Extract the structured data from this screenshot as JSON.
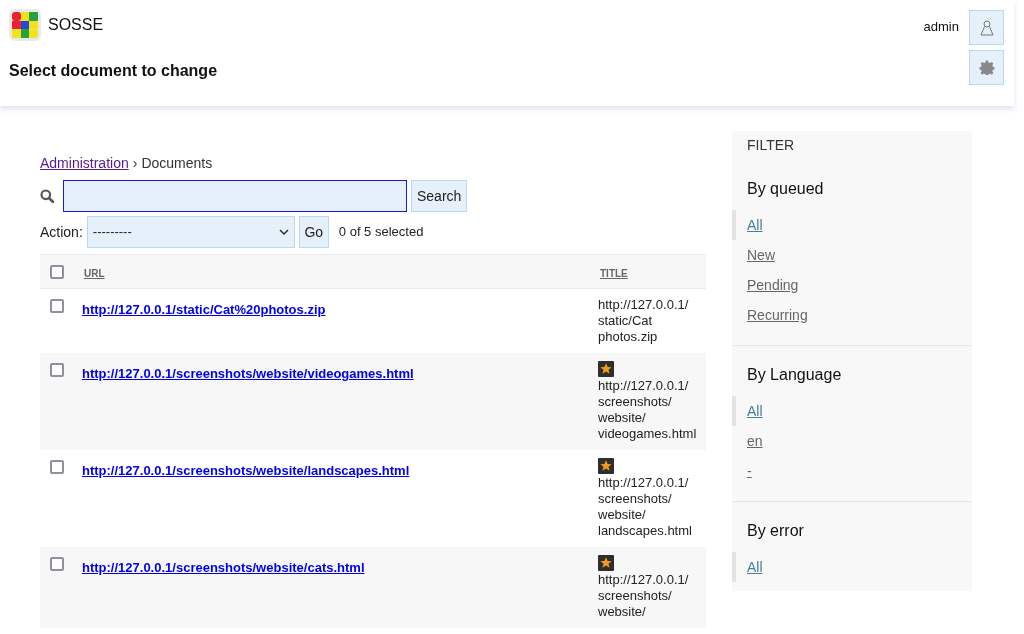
{
  "header": {
    "brand": "SOSSE",
    "page_title": "Select document to change",
    "username": "admin"
  },
  "breadcrumb": {
    "link": "Administration",
    "separator": "›",
    "current": "Documents"
  },
  "search": {
    "focused": true,
    "button": "Search"
  },
  "actions": {
    "label": "Action:",
    "selected_option": "---------",
    "button": "Go",
    "counter": "0 of 5 selected"
  },
  "table": {
    "select_all": {
      "checked": false
    },
    "columns": [
      "URL",
      "TITLE"
    ],
    "rows": [
      {
        "url": "http://127.0.0.1/static/Cat%20photos.zip",
        "title": "http://127.0.0.1/static/Cat photos.zip",
        "has_icon": false,
        "checked": false
      },
      {
        "url": "http://127.0.0.1/screenshots/website/videogames.html",
        "title": "http://127.0.0.1/screenshots/website/videogames.html",
        "has_icon": true,
        "checked": false
      },
      {
        "url": "http://127.0.0.1/screenshots/website/landscapes.html",
        "title": "http://127.0.0.1/screenshots/website/landscapes.html",
        "has_icon": true,
        "checked": false
      },
      {
        "url": "http://127.0.0.1/screenshots/website/cats.html",
        "title": "http://127.0.0.1/screenshots/website/",
        "has_icon": true,
        "checked": false
      }
    ]
  },
  "filter": {
    "heading": "FILTER",
    "groups": [
      {
        "title": "By queued",
        "options": [
          {
            "label": "All",
            "selected": true
          },
          {
            "label": "New",
            "selected": false
          },
          {
            "label": "Pending",
            "selected": false
          },
          {
            "label": "Recurring",
            "selected": false
          }
        ]
      },
      {
        "title": "By Language",
        "options": [
          {
            "label": "All",
            "selected": true
          },
          {
            "label": "en",
            "selected": false
          },
          {
            "label": "-",
            "selected": false
          }
        ]
      },
      {
        "title": "By error",
        "options": [
          {
            "label": "All",
            "selected": true
          }
        ]
      }
    ]
  }
}
